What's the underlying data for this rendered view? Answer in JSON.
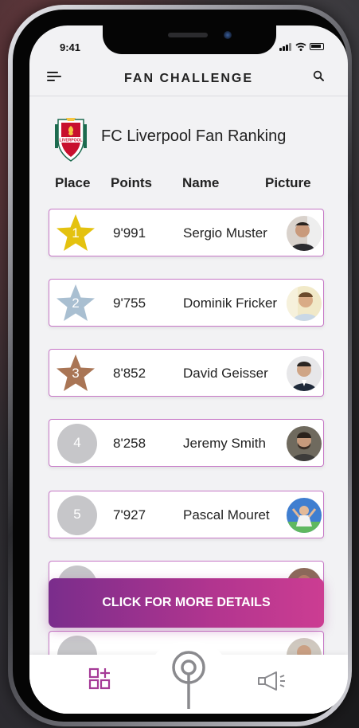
{
  "status_bar": {
    "time": "9:41"
  },
  "header": {
    "title": "FAN CHALLENGE"
  },
  "ranking": {
    "title": "FC Liverpool Fan Ranking",
    "crest_text": "LIVERPOOL",
    "columns": [
      "Place",
      "Points",
      "Name",
      "Picture"
    ],
    "rows": [
      {
        "place": "1",
        "points": "9'991",
        "name": "Sergio Muster",
        "badge": "gold-star",
        "badge_color": "#e4c20f"
      },
      {
        "place": "2",
        "points": "9'755",
        "name": "Dominik Fricker",
        "badge": "silver-star",
        "badge_color": "#a9bfd1"
      },
      {
        "place": "3",
        "points": "8'852",
        "name": "David Geisser",
        "badge": "bronze-star",
        "badge_color": "#a97555"
      },
      {
        "place": "4",
        "points": "8'258",
        "name": "Jeremy Smith",
        "badge": "circle",
        "badge_color": "#c6c6c9"
      },
      {
        "place": "5",
        "points": "7'927",
        "name": "Pascal Mouret",
        "badge": "circle",
        "badge_color": "#c6c6c9"
      },
      {
        "place": "",
        "points": "",
        "name": "",
        "badge": "circle",
        "badge_color": "#c6c6c9"
      },
      {
        "place": "",
        "points": "",
        "name": "",
        "badge": "circle",
        "badge_color": "#c6c6c9"
      }
    ]
  },
  "cta": {
    "label": "CLICK FOR MORE DETAILS"
  },
  "tabbar": {
    "items": [
      {
        "icon": "grid-add-icon",
        "active": true
      },
      {
        "icon": "radio-tower-icon",
        "active": false
      },
      {
        "icon": "megaphone-icon",
        "active": false
      }
    ]
  },
  "colors": {
    "accent": "#a53a97",
    "row_border": "#c778c7",
    "cta_start": "#7a2d8c",
    "cta_end": "#cc3d92"
  }
}
